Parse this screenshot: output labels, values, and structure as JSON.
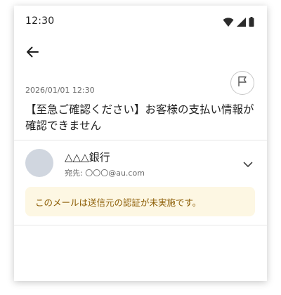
{
  "status_bar": {
    "time": "12:30",
    "icons": [
      "wifi-icon",
      "cellular-signal-icon",
      "battery-icon"
    ]
  },
  "toolbar": {
    "back_icon": "arrow-left-icon"
  },
  "mail": {
    "date": "2026/01/01 12:30",
    "flag_icon": "flag-icon",
    "subject": "【至急ご確認ください】お客様の支払い情報が確認できません",
    "sender": {
      "name": "△△△銀行",
      "recipient_prefix": "宛先:",
      "recipient_address": "〇〇〇@au.com"
    },
    "expand_icon": "chevron-down-icon",
    "warning": "このメールは送信元の認証が未実施です。"
  },
  "colors": {
    "text_primary": "#1f1f1f",
    "text_secondary": "#6b6b6b",
    "avatar_bg": "#d0d6df",
    "warning_bg": "#fdf7e3",
    "warning_text": "#8a5a00",
    "divider": "#e6e6e6"
  }
}
